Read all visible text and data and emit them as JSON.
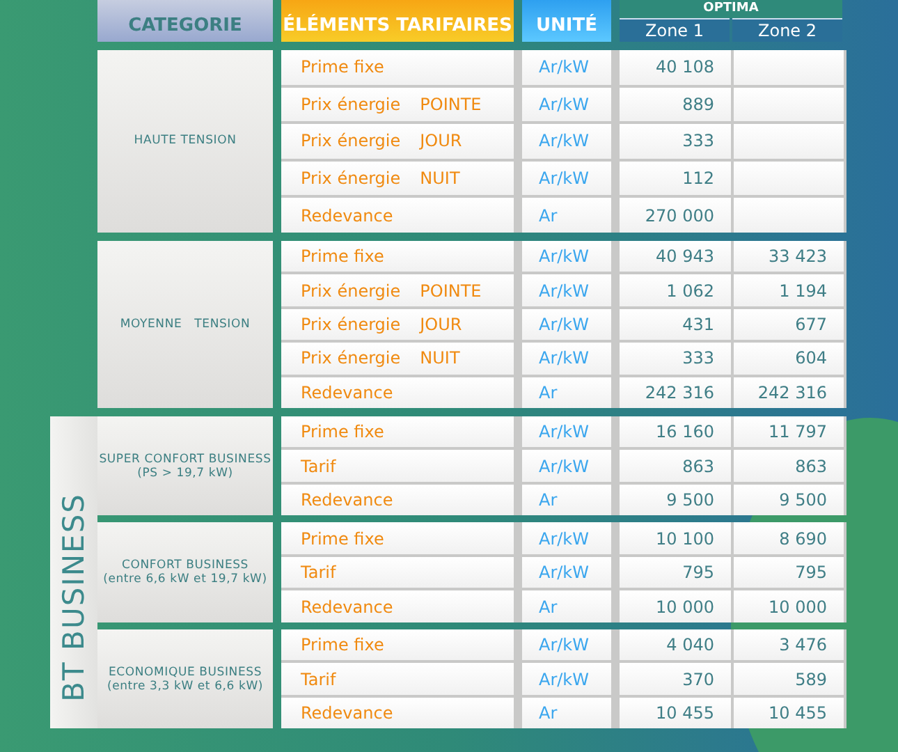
{
  "header": {
    "category": "CATEGORIE",
    "elements": "ÉLÉMENTS TARIFAIRES",
    "unit": "UNITÉ",
    "option": "OPTIMA",
    "zones": [
      "Zone 1",
      "Zone 2"
    ]
  },
  "groups": [
    {
      "category": "HAUTE TENSION",
      "rows": [
        {
          "label": "Prime fixe",
          "unit": "Ar/kW",
          "zone_1": "40 108"
        },
        {
          "label": "Prix énergie",
          "period": "POINTE",
          "unit": "Ar/kW",
          "zone_1": "889"
        },
        {
          "label": "Prix énergie",
          "period": "JOUR",
          "unit": "Ar/kW",
          "zone_1": "333"
        },
        {
          "label": "Prix énergie",
          "period": "NUIT",
          "unit": "Ar/kW",
          "zone_1": "112"
        },
        {
          "label": "Redevance",
          "unit": "Ar",
          "zone_1": "270 000"
        }
      ]
    },
    {
      "category": "MOYENNE   TENSION",
      "rows": [
        {
          "label": "Prime fixe",
          "unit": "Ar/kW",
          "zone_1": "40 943",
          "zone_2": "33 423"
        },
        {
          "label": "Prix énergie",
          "period": "POINTE",
          "unit": "Ar/kW",
          "zone_1": "1 062",
          "zone_2": "1 194"
        },
        {
          "label": "Prix énergie",
          "period": "JOUR",
          "unit": "Ar/kW",
          "zone_1": "431",
          "zone_2": "677"
        },
        {
          "label": "Prix énergie",
          "period": "NUIT",
          "unit": "Ar/kW",
          "zone_1": "333",
          "zone_2": "604"
        },
        {
          "label": "Redevance",
          "unit": "Ar",
          "zone_1": "242 316",
          "zone_2": "242 316"
        }
      ]
    }
  ],
  "bt_section": {
    "title": "BT BUSINESS",
    "groups": [
      {
        "category": "SUPER CONFORT BUSINESS",
        "note": "(PS > 19,7 kW)",
        "rows": [
          {
            "label": "Prime fixe",
            "unit": "Ar/kW",
            "zone_1": "16 160",
            "zone_2": "11 797"
          },
          {
            "label": "Tarif",
            "unit": "Ar/kW",
            "zone_1": "863",
            "zone_2": "863"
          },
          {
            "label": "Redevance",
            "unit": "Ar",
            "zone_1": "9 500",
            "zone_2": "9 500"
          }
        ]
      },
      {
        "category": "CONFORT BUSINESS",
        "note": "(entre 6,6 kW et 19,7 kW)",
        "rows": [
          {
            "label": "Prime fixe",
            "unit": "Ar/kW",
            "zone_1": "10 100",
            "zone_2": "8 690"
          },
          {
            "label": "Tarif",
            "unit": "Ar/kW",
            "zone_1": "795",
            "zone_2": "795"
          },
          {
            "label": "Redevance",
            "unit": "Ar",
            "zone_1": "10 000",
            "zone_2": "10 000"
          }
        ]
      },
      {
        "category": "ECONOMIQUE BUSINESS",
        "note": "(entre 3,3 kW et 6,6 kW)",
        "rows": [
          {
            "label": "Prime fixe",
            "unit": "Ar/kW",
            "zone_1": "4 040",
            "zone_2": "3 476"
          },
          {
            "label": "Tarif",
            "unit": "Ar/kW",
            "zone_1": "370",
            "zone_2": "589"
          },
          {
            "label": "Redevance",
            "unit": "Ar",
            "zone_1": "10 455",
            "zone_2": "10 455"
          }
        ]
      }
    ]
  }
}
